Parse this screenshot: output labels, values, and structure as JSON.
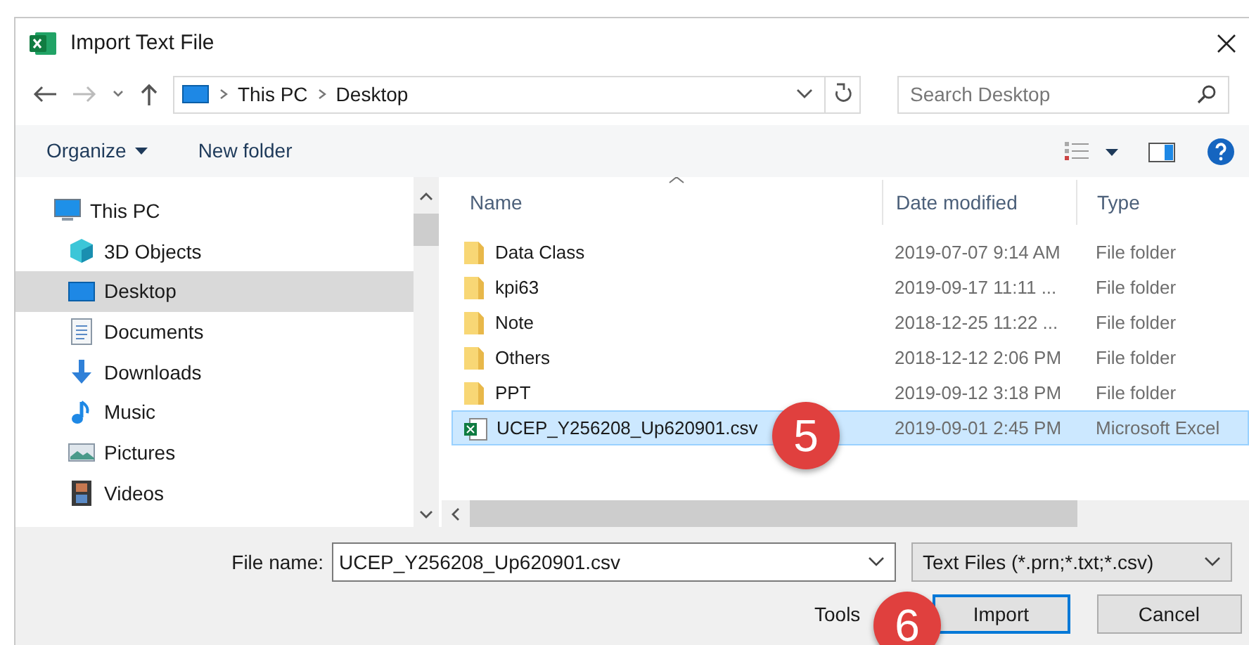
{
  "window": {
    "title": "Import Text File"
  },
  "address_bar": {
    "crumbs": [
      "This PC",
      "Desktop"
    ]
  },
  "search": {
    "placeholder": "Search Desktop"
  },
  "toolbar": {
    "organize": "Organize",
    "new_folder": "New folder"
  },
  "sidebar": {
    "items": [
      {
        "label": "This PC",
        "kind": "pc",
        "selected": false,
        "children": [
          {
            "label": "3D Objects",
            "kind": "cube",
            "selected": false
          },
          {
            "label": "Desktop",
            "kind": "desktop",
            "selected": true
          },
          {
            "label": "Documents",
            "kind": "document",
            "selected": false
          },
          {
            "label": "Downloads",
            "kind": "download",
            "selected": false
          },
          {
            "label": "Music",
            "kind": "music",
            "selected": false
          },
          {
            "label": "Pictures",
            "kind": "pictures",
            "selected": false
          },
          {
            "label": "Videos",
            "kind": "videos",
            "selected": false
          }
        ]
      }
    ]
  },
  "file_list": {
    "columns": [
      "Name",
      "Date modified",
      "Type"
    ],
    "rows": [
      {
        "name": "Data Class",
        "date": "2019-07-07 9:14 AM",
        "type": "File folder",
        "kind": "folder",
        "selected": false
      },
      {
        "name": "kpi63",
        "date": "2019-09-17 11:11 ...",
        "type": "File folder",
        "kind": "folder",
        "selected": false
      },
      {
        "name": "Note",
        "date": "2018-12-25 11:22 ...",
        "type": "File folder",
        "kind": "folder",
        "selected": false
      },
      {
        "name": "Others",
        "date": "2018-12-12 2:06 PM",
        "type": "File folder",
        "kind": "folder",
        "selected": false
      },
      {
        "name": "PPT",
        "date": "2019-09-12 3:18 PM",
        "type": "File folder",
        "kind": "folder",
        "selected": false
      },
      {
        "name": "UCEP_Y256208_Up620901.csv",
        "date": "2019-09-01 2:45 PM",
        "type": "Microsoft Excel",
        "kind": "excel",
        "selected": true
      }
    ]
  },
  "footer": {
    "file_name_label": "File name:",
    "file_name": "UCEP_Y256208_Up620901.csv",
    "file_type": "Text Files (*.prn;*.txt;*.csv)",
    "tools": "Tools",
    "buttons": [
      "Import",
      "Cancel"
    ]
  },
  "callouts": [
    "5",
    "6"
  ]
}
